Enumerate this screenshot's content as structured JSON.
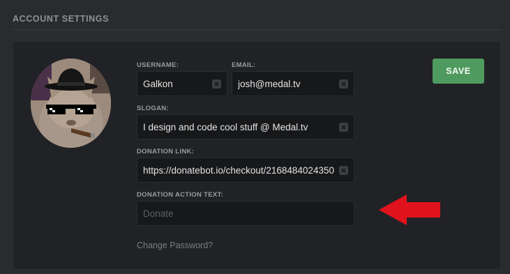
{
  "section": {
    "title": "ACCOUNT SETTINGS"
  },
  "profile": {
    "username_label": "USERNAME:",
    "username_value": "Galkon",
    "email_label": "EMAIL:",
    "email_value": "josh@medal.tv",
    "slogan_label": "SLOGAN:",
    "slogan_value": "I design and code cool stuff @ Medal.tv",
    "donation_link_label": "DONATION LINK:",
    "donation_link_value": "https://donatebot.io/checkout/2168484024350",
    "donation_action_label": "DONATION ACTION TEXT:",
    "donation_action_value": "",
    "donation_action_placeholder": "Donate"
  },
  "actions": {
    "save_label": "SAVE",
    "change_password_label": "Change Password?"
  },
  "icons": {
    "clear": "close-icon",
    "annotation": "red-arrow-icon",
    "avatar": "cat-avatar"
  },
  "colors": {
    "background": "#2a2b2e",
    "card": "#212225",
    "input": "#17181a",
    "save_button": "#4f9b5f",
    "arrow": "#e0131c"
  }
}
